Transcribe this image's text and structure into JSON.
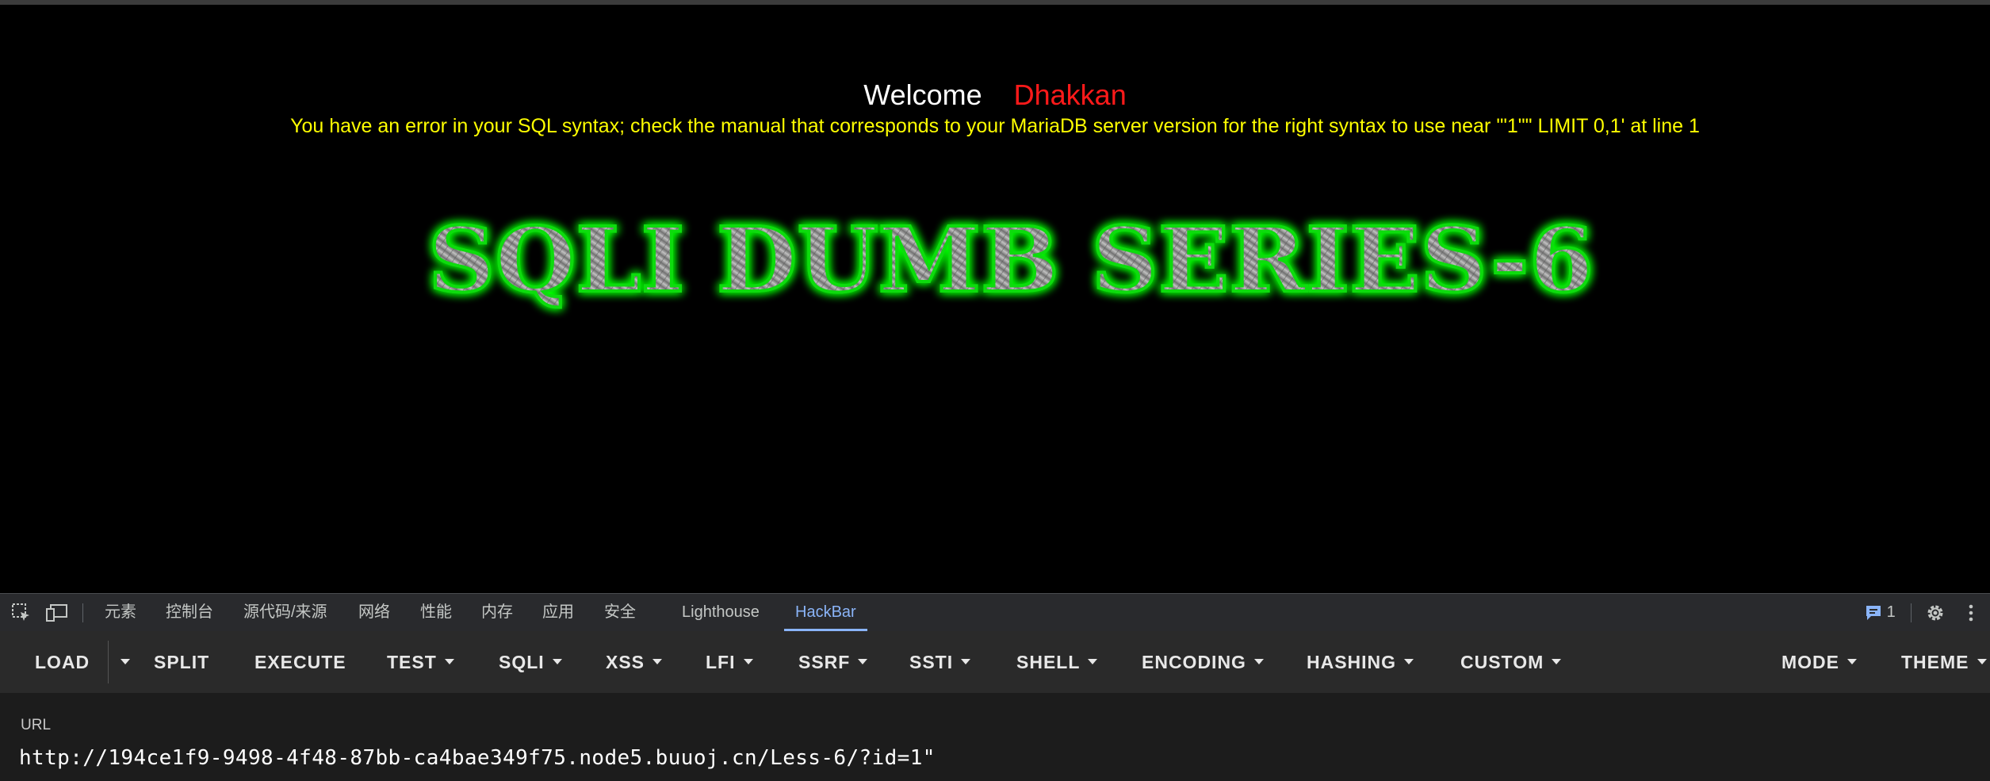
{
  "page": {
    "welcome_word": "Welcome",
    "user_name": "Dhakkan",
    "error_message": "You have an error in your SQL syntax; check the manual that corresponds to your MariaDB server version for the right syntax to use near '\"1\"\" LIMIT 0,1' at line 1",
    "banner_text": "SQLI DUMB SERIES-6"
  },
  "devtools": {
    "tabs": [
      {
        "label": "元素"
      },
      {
        "label": "控制台"
      },
      {
        "label": "源代码/来源"
      },
      {
        "label": "网络"
      },
      {
        "label": "性能"
      },
      {
        "label": "内存"
      },
      {
        "label": "应用"
      },
      {
        "label": "安全"
      },
      {
        "label": "Lighthouse"
      },
      {
        "label": "HackBar"
      }
    ],
    "active_tab": "HackBar",
    "issues_count": "1",
    "icons": [
      "inspect-element-icon",
      "device-toolbar-icon",
      "issues-icon",
      "settings-gear-icon",
      "more-vertical-icon"
    ]
  },
  "hackbar": {
    "buttons": [
      {
        "label": "LOAD"
      },
      {
        "label": "SPLIT"
      },
      {
        "label": "EXECUTE"
      },
      {
        "label": "TEST"
      },
      {
        "label": "SQLI"
      },
      {
        "label": "XSS"
      },
      {
        "label": "LFI"
      },
      {
        "label": "SSRF"
      },
      {
        "label": "SSTI"
      },
      {
        "label": "SHELL"
      },
      {
        "label": "ENCODING"
      },
      {
        "label": "HASHING"
      },
      {
        "label": "CUSTOM"
      },
      {
        "label": "MODE"
      },
      {
        "label": "THEME"
      }
    ],
    "url_label": "URL",
    "url_value": "http://194ce1f9-9498-4f48-87bb-ca4bae349f75.node5.buuoj.cn/Less-6/?id=1\""
  },
  "colors": {
    "background": "#000000",
    "welcome": "#ffffff",
    "user_name": "#ff1a1a",
    "error": "#ffff00",
    "banner_glow": "#00ff00",
    "active_tab": "#8ab4f8"
  }
}
